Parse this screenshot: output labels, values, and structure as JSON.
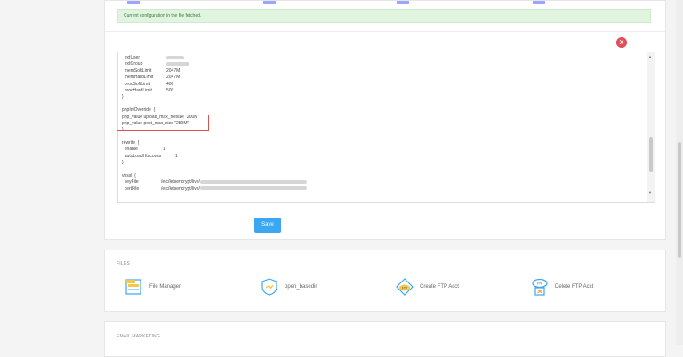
{
  "alert": {
    "message": "Current configuration in the file fetched."
  },
  "editor": {
    "lines": [
      {
        "key": "  extUser",
        "value": "",
        "blur": 20
      },
      {
        "key": "  extGroup",
        "value": "",
        "blur": 26
      },
      {
        "key": "  memSoftLimit",
        "value": "2047M"
      },
      {
        "key": "  memHardLimit",
        "value": "2047M"
      },
      {
        "key": "  procSoftLimit",
        "value": "400"
      },
      {
        "key": "  procHardLimit",
        "value": "500"
      },
      {
        "key": "}",
        "value": ""
      },
      {
        "key": "",
        "value": ""
      },
      {
        "key": "phpIniOverride  {",
        "value": ""
      },
      {
        "key": "php_value upload_max_filesize \"200M\"",
        "value": ""
      },
      {
        "key": "php_value post_max_size \"250M\"",
        "value": ""
      },
      {
        "key": "}",
        "value": ""
      },
      {
        "key": "",
        "value": ""
      },
      {
        "key": "rewrite  {",
        "value": ""
      },
      {
        "key": "  enable",
        "value": "1"
      },
      {
        "key": "  autoLoadHtaccess",
        "value": "1"
      },
      {
        "key": "}",
        "value": ""
      },
      {
        "key": "",
        "value": ""
      },
      {
        "key": "vhssl  {",
        "value": ""
      },
      {
        "key": "  keyFile",
        "value": "/etc/letsencrypt/live/",
        "blur": 120
      },
      {
        "key": "  certFile",
        "value": "/etc/letsencrypt/live/",
        "blur": 120
      }
    ]
  },
  "save_label": "Save",
  "files": {
    "title": "FILES",
    "items": [
      {
        "label": "File Manager",
        "icon": "folder-icon"
      },
      {
        "label": "open_basedir",
        "icon": "shield-icon"
      },
      {
        "label": "Create FTP Acct",
        "icon": "cloud-ftp-icon"
      },
      {
        "label": "Delete FTP Acct",
        "icon": "ftp-delete-icon"
      }
    ]
  },
  "email": {
    "title": "EMAIL MARKETING"
  },
  "colors": {
    "accent": "#3ba7f2",
    "danger": "#e04e57",
    "success_bg": "#e0f4df"
  }
}
